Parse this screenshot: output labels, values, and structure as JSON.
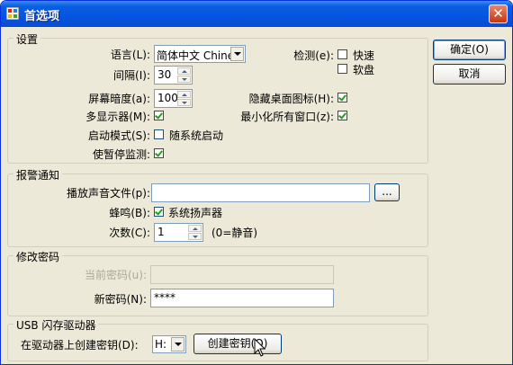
{
  "window": {
    "title": "首选项",
    "close_label": "✕"
  },
  "settings": {
    "legend": "设置",
    "language_label": "语言(L):",
    "language_value": "简体中文 Chines",
    "interval_label": "间隔(I):",
    "interval_value": "30",
    "brightness_label": "屏幕暗度(a):",
    "brightness_value": "100",
    "multi_monitor_label": "多显示器(M):",
    "startup_label": "启动模式(S):",
    "startup_text": "随系统启动",
    "pause_label": "使暂停监测:",
    "detect_label": "检测(e):",
    "fast_label": "快速",
    "soft_label": "软盘",
    "hide_icons_label": "隐藏桌面图标(H):",
    "minimize_label": "最小化所有窗口(z):"
  },
  "alarm": {
    "legend": "报警通知",
    "sound_label": "播放声音文件(p):",
    "sound_value": "",
    "browse_label": "...",
    "beep_label": "蜂鸣(B):",
    "beep_text": "系统扬声器",
    "count_label": "次数(C):",
    "count_value": "1",
    "count_note": "(0=静音)"
  },
  "password": {
    "legend": "修改密码",
    "current_label": "当前密码(u):",
    "current_value": "",
    "new_label": "新密码(N):",
    "new_value": "****"
  },
  "usb": {
    "legend": "USB 闪存驱动器",
    "drive_label": "在驱动器上创建密钥(D):",
    "drive_value": "H:",
    "create_label": "创建密钥(Q)"
  },
  "buttons": {
    "ok": "确定(O)",
    "cancel": "取消"
  },
  "checks": {
    "fast": false,
    "soft": false,
    "hide_icons": true,
    "minimize": true,
    "multi_monitor": true,
    "startup": false,
    "pause": true,
    "beep": true
  }
}
